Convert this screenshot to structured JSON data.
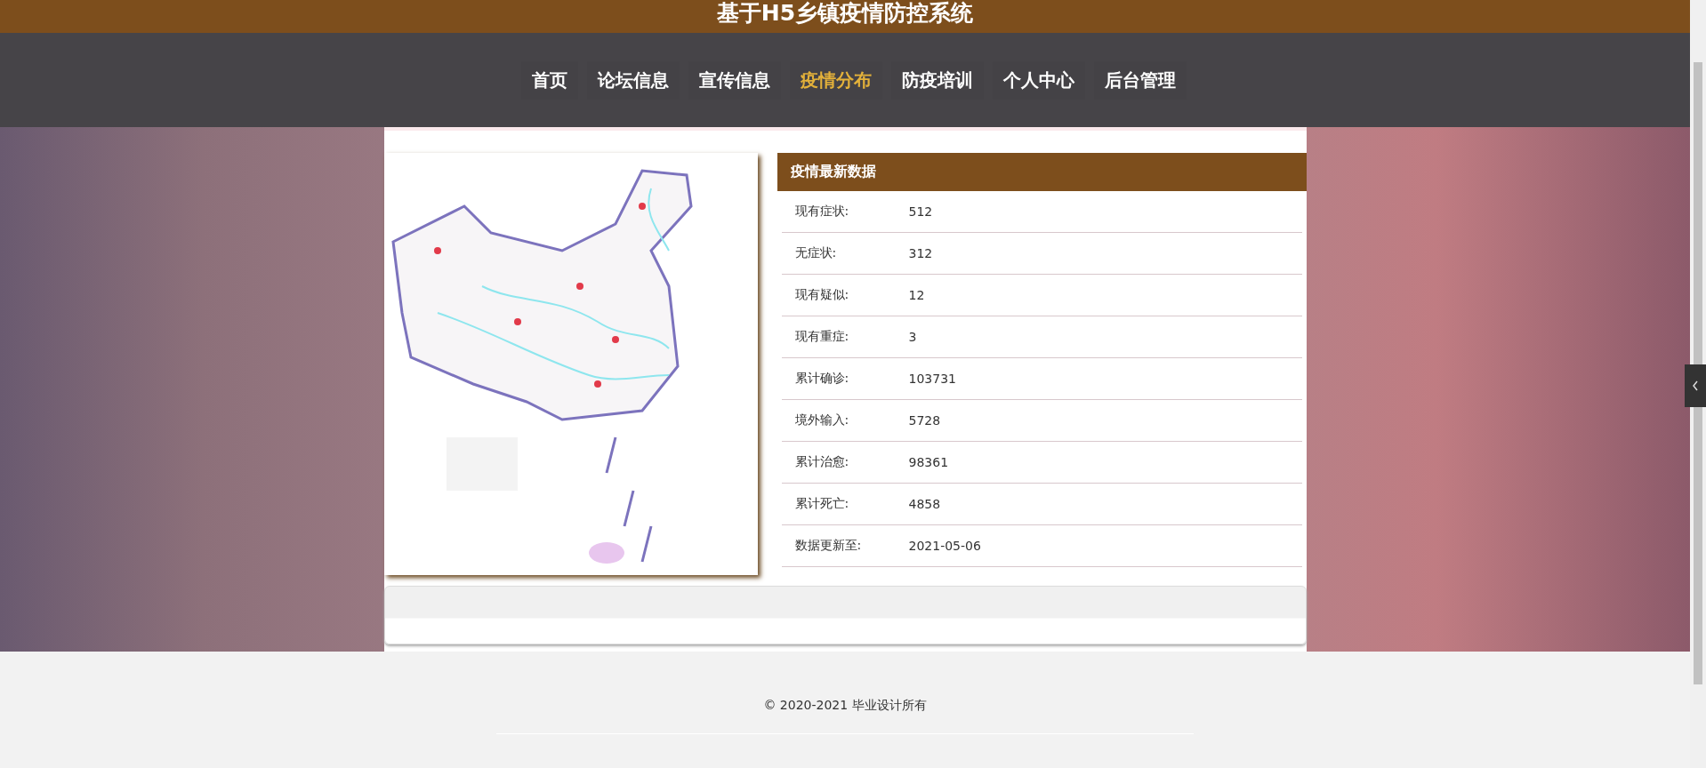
{
  "header": {
    "title": "基于H5乡镇疫情防控系统"
  },
  "nav": [
    {
      "label": "首页",
      "selected": false
    },
    {
      "label": "论坛信息",
      "selected": false
    },
    {
      "label": "宣传信息",
      "selected": false
    },
    {
      "label": "疫情分布",
      "selected": true
    },
    {
      "label": "防疫培训",
      "selected": false
    },
    {
      "label": "个人中心",
      "selected": false
    },
    {
      "label": "后台管理",
      "selected": false
    }
  ],
  "stats": {
    "title": "疫情最新数据",
    "rows": [
      {
        "label": "现有症状:",
        "value": "512"
      },
      {
        "label": "无症状:",
        "value": "312"
      },
      {
        "label": "现有疑似:",
        "value": "12"
      },
      {
        "label": "现有重症:",
        "value": "3"
      },
      {
        "label": "累计确诊:",
        "value": "103731"
      },
      {
        "label": "境外输入:",
        "value": "5728"
      },
      {
        "label": "累计治愈:",
        "value": "98361"
      },
      {
        "label": "累计死亡:",
        "value": "4858"
      },
      {
        "label": "数据更新至:",
        "value": "2021-05-06"
      }
    ]
  },
  "footer": {
    "copyright": "© 2020-2021 毕业设计所有"
  }
}
